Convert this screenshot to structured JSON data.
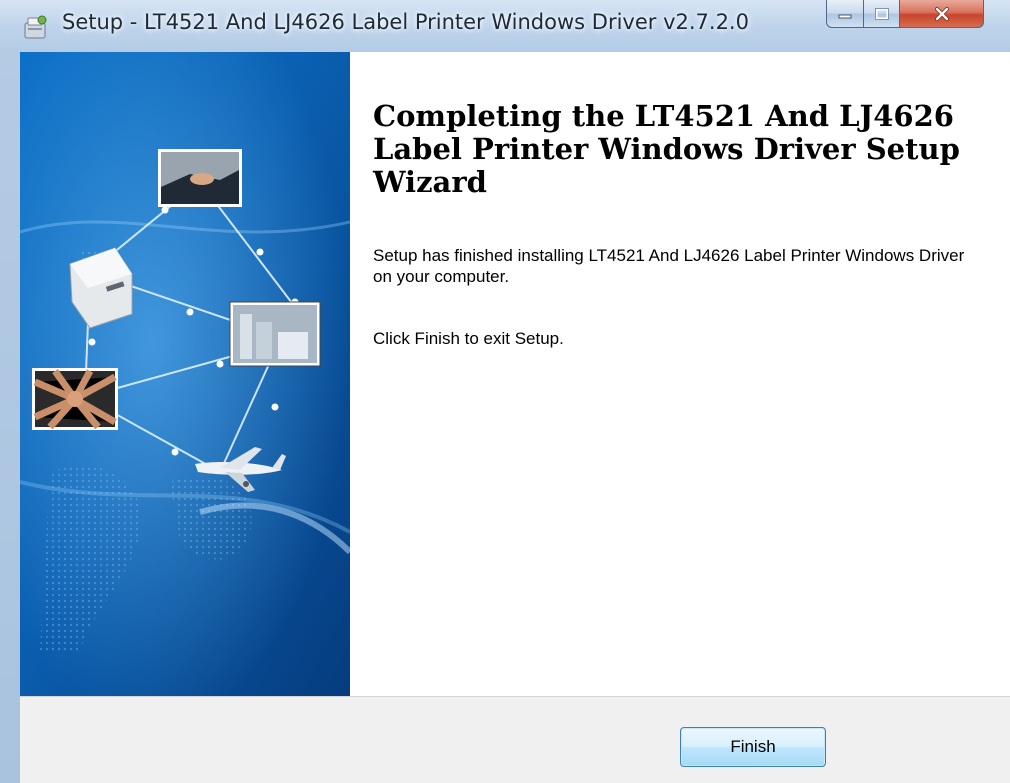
{
  "window": {
    "title": "Setup - LT4521 And LJ4626 Label Printer Windows Driver v2.7.2.0",
    "caption_buttons": [
      "minimize",
      "maximize",
      "close"
    ]
  },
  "wizard": {
    "heading": "Completing the LT4521 And LJ4626 Label Printer Windows Driver Setup Wizard",
    "message": "Setup has finished installing LT4521 And LJ4626 Label Printer Windows Driver on your computer.",
    "instruction": "Click Finish to exit Setup."
  },
  "footer": {
    "finish_label": "Finish"
  },
  "icons": {
    "title_icon": "setup-installer-icon",
    "sidebar_images": [
      "handshake-image",
      "receipt-printer-image",
      "factory-image",
      "teamwork-hands-image",
      "airplane-image"
    ]
  },
  "colors": {
    "sidebar_blue": "#0a5fb0",
    "close_button": "#c7452b",
    "finish_border": "#3c7fb1"
  }
}
